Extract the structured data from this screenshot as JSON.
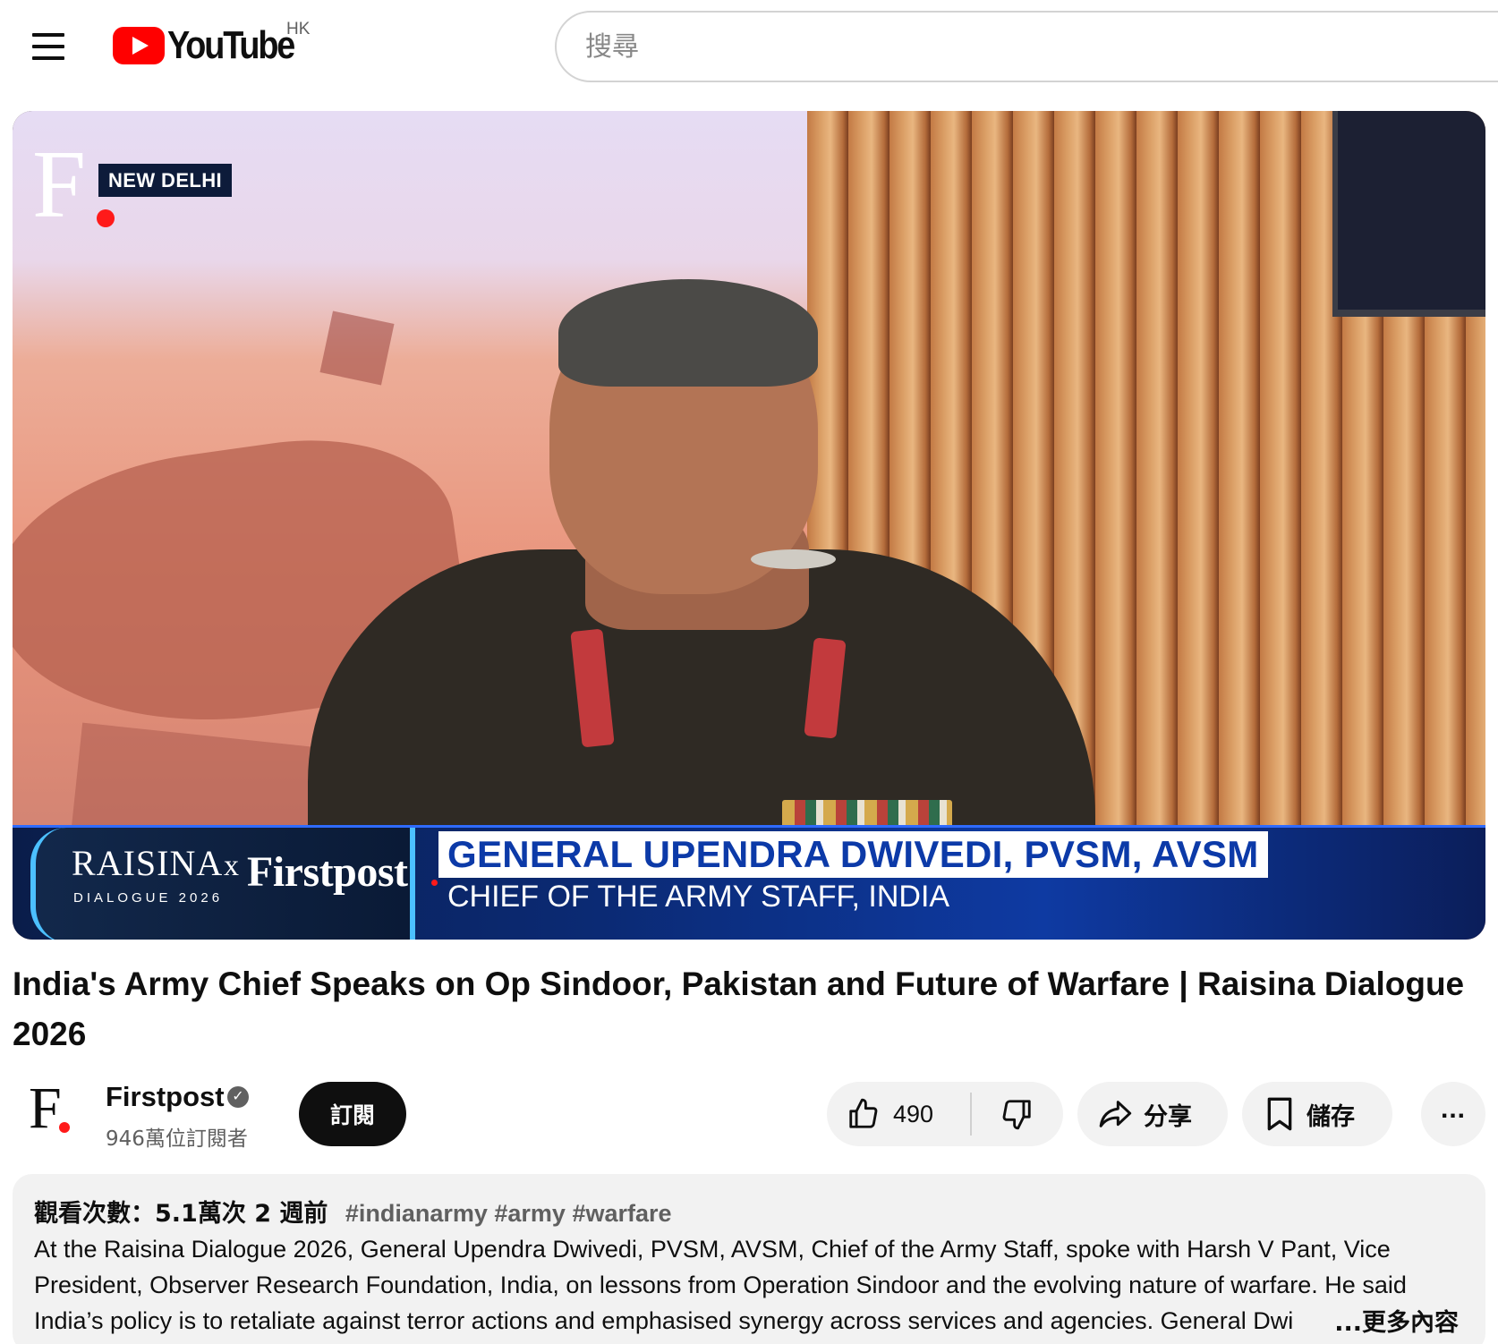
{
  "masthead": {
    "logo_text": "YouTube",
    "region": "HK",
    "search_placeholder": "搜尋"
  },
  "player": {
    "overlay_location": "NEW DELHI",
    "brand_raisina": "RAISINA",
    "brand_dialogue": "DIALOGUE 2026",
    "brand_x": "x",
    "brand_firstpost": "Firstpost",
    "lower_third_name": "GENERAL UPENDRA DWIVEDI, PVSM, AVSM",
    "lower_third_role": "CHIEF OF THE ARMY STAFF, INDIA",
    "channel_logo_letter": "F"
  },
  "video": {
    "title": "India's Army Chief Speaks on Op Sindoor, Pakistan and Future of Warfare | Raisina Dialogue 2026"
  },
  "owner": {
    "avatar_letter": "F",
    "channel_name": "Firstpost",
    "verified_mark": "✓",
    "subscriber_count": "946萬位訂閱者",
    "subscribe_label": "訂閱"
  },
  "actions": {
    "like_count": "490",
    "share_label": "分享",
    "save_label": "儲存",
    "more_label": "..."
  },
  "description": {
    "meta": "觀看次數：5.1萬次  2 週前",
    "hashtags": "#indianarmy #army #warfare",
    "text": "At the Raisina Dialogue 2026, General Upendra Dwivedi, PVSM, AVSM, Chief of the Army Staff, spoke with Harsh V Pant, Vice President, Observer Research Foundation, India, on lessons from Operation Sindoor and the evolving nature of warfare. He said India’s policy is to retaliate against terror actions and emphasised synergy across services and agencies. General Dwi",
    "more_label": "...更多內容"
  },
  "colors": {
    "brand_red": "#ff0000",
    "subscribe_bg": "#0f0f0f",
    "pill_bg": "#f2f2f2",
    "lower_third_blue": "#0b2a74",
    "lower_third_name_text": "#0c3aa8"
  }
}
